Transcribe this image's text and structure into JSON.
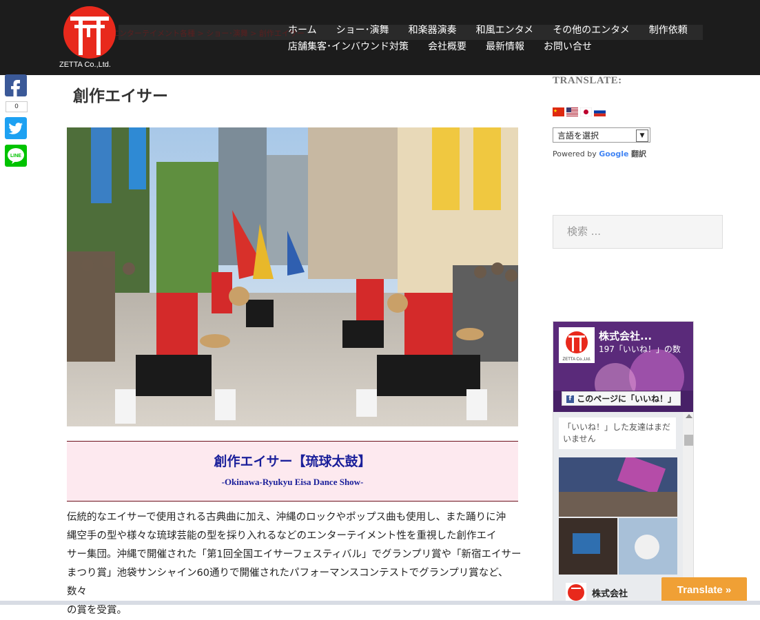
{
  "header": {
    "logo_text": "ZETTA Co.,Ltd.",
    "breadcrumb": "エンターテイメント各種 > ショー･演舞 > 創作エイサー",
    "nav_row1": [
      "ホーム",
      "ショー･演舞",
      "和楽器演奏",
      "和風エンタメ",
      "その他のエンタメ",
      "制作依頼"
    ],
    "nav_row2": [
      "店舗集客･インバウンド対策",
      "会社概要",
      "最新情報",
      "お問い合せ"
    ]
  },
  "share": {
    "count": "0"
  },
  "main": {
    "page_title": "創作エイサー",
    "caption_title": "創作エイサー【琉球太鼓】",
    "caption_subtitle": "-Okinawa-Ryukyu Eisa Dance Show-",
    "body_lines": [
      "伝統的なエイサーで使用される古典曲に加え、沖縄のロックやポップス曲も使用し、また踊りに沖",
      "縄空手の型や様々な琉球芸能の型を採り入れるなどのエンターテイメント性を重視した創作エイ",
      "サー集団。沖縄で開催された「第1回全国エイサーフェスティバル」でグランプリ賞や「新宿エイサー",
      "まつり賞」池袋サンシャイン60通りで開催されたパフォーマンスコンテストでグランプリ賞など、数々",
      "の賞を受賞。"
    ]
  },
  "sidebar": {
    "translate_label": "TRANSLATE:",
    "language_select": "言語を選択",
    "powered_by": "Powered by",
    "google": "Google",
    "translate_word": "翻訳",
    "search_placeholder": "検索 ...",
    "fb": {
      "page_name": "株式会社...",
      "likes": "197「いいね！」の数",
      "like_button": "このページに「いいね！」",
      "friends_text": "「いいね！」した友達はまだいません",
      "footer_name": "株式会社"
    }
  },
  "translate_button": "Translate »",
  "colors": {
    "header_bg": "#1c1c1c",
    "caption_bg": "#fde9ef",
    "caption_text": "#1a1f9a",
    "accent_orange": "#f0a035"
  }
}
